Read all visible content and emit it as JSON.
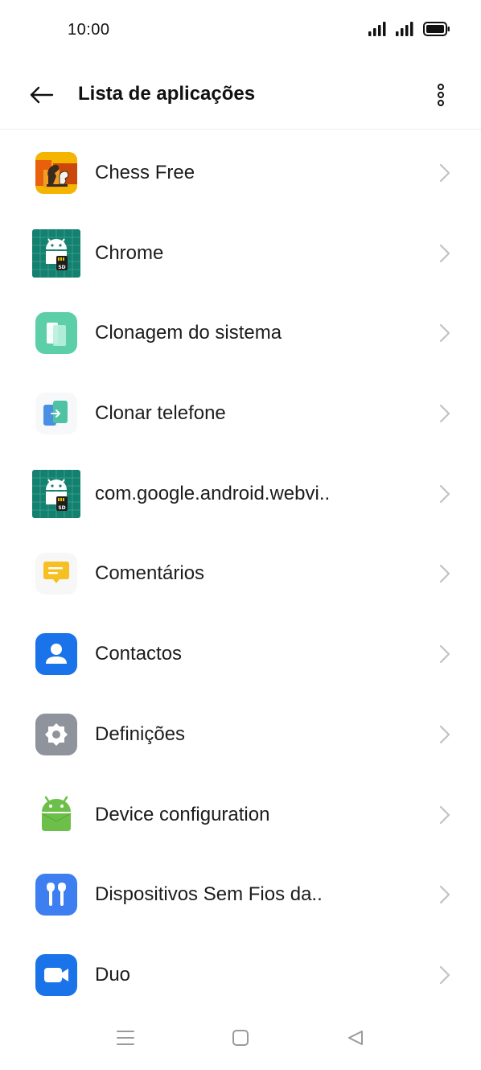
{
  "status_bar": {
    "time": "10:00"
  },
  "header": {
    "title": "Lista de aplicações"
  },
  "apps": [
    {
      "label": "Chess Free",
      "icon": "chess-free-icon"
    },
    {
      "label": "Chrome",
      "icon": "android-sd-icon"
    },
    {
      "label": "Clonagem do sistema",
      "icon": "system-clone-icon"
    },
    {
      "label": "Clonar telefone",
      "icon": "clone-phone-icon"
    },
    {
      "label": "com.google.android.webvi..",
      "icon": "android-sd-icon"
    },
    {
      "label": "Comentários",
      "icon": "feedback-icon"
    },
    {
      "label": "Contactos",
      "icon": "contacts-icon"
    },
    {
      "label": "Definições",
      "icon": "settings-icon"
    },
    {
      "label": "Device configuration",
      "icon": "android-icon"
    },
    {
      "label": "Dispositivos Sem Fios da..",
      "icon": "earbuds-icon"
    },
    {
      "label": "Duo",
      "icon": "duo-video-icon"
    }
  ],
  "colors": {
    "accent_blue": "#1a73e8",
    "teal": "#14806f",
    "mint": "#5ccfa9",
    "chevron": "#c2c2c2"
  }
}
